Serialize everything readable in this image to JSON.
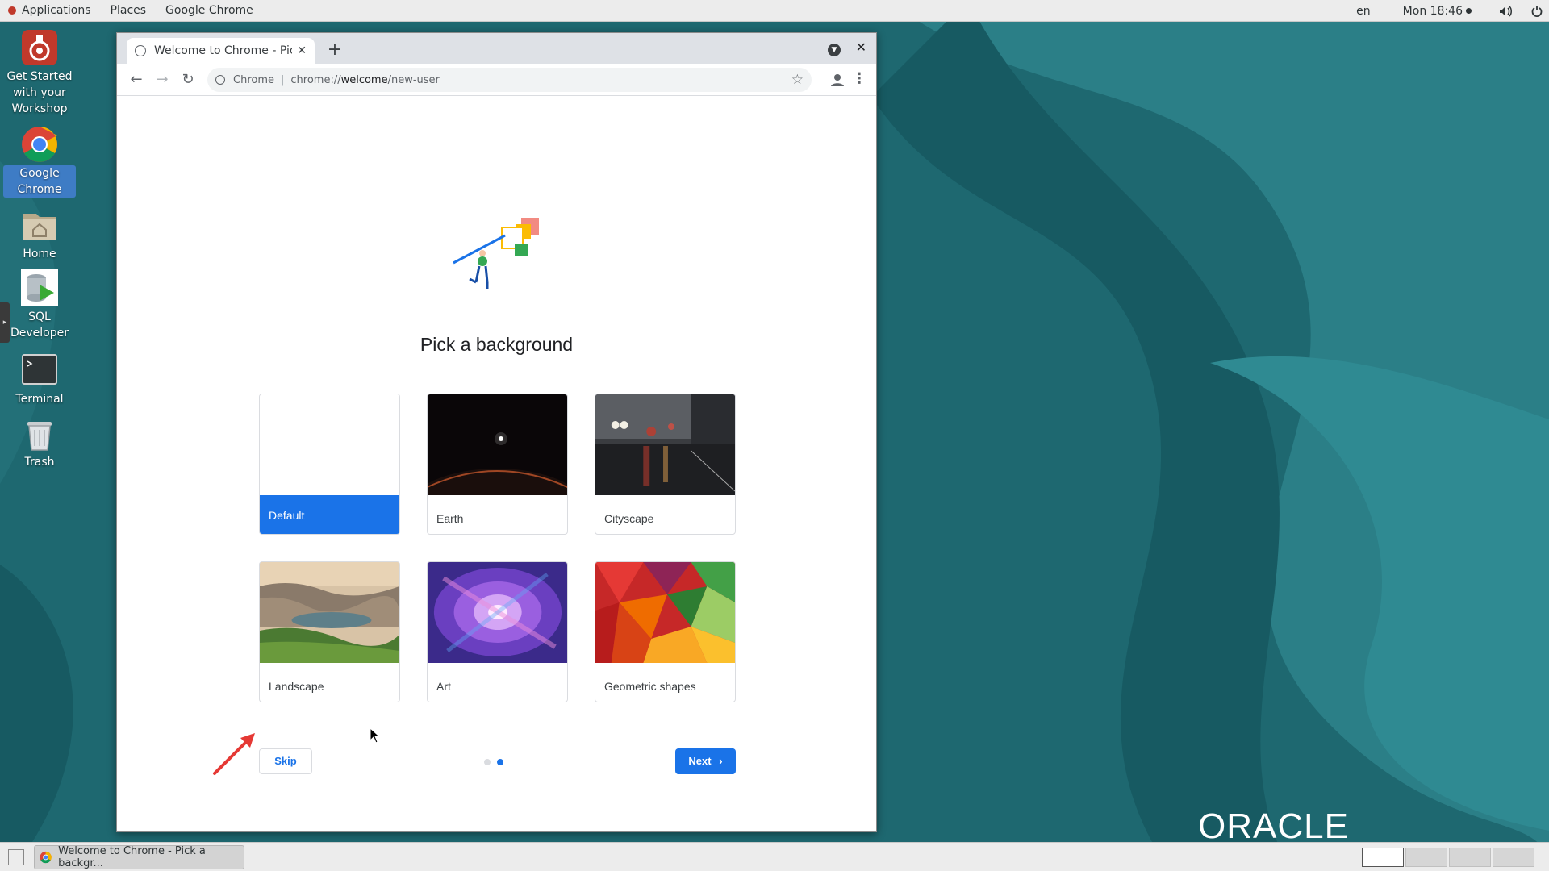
{
  "topbar": {
    "applications": "Applications",
    "places": "Places",
    "app_menu": "Google Chrome",
    "lang": "en",
    "clock": "Mon 18:46"
  },
  "desktop_icons": [
    {
      "label": "Get Started with your Workshop",
      "icon": "workshop-icon"
    },
    {
      "label": "Google Chrome",
      "icon": "chrome-icon"
    },
    {
      "label": "Home",
      "icon": "home-folder-icon"
    },
    {
      "label": "SQL Developer",
      "icon": "sql-developer-icon"
    },
    {
      "label": "Terminal",
      "icon": "terminal-icon"
    },
    {
      "label": "Trash",
      "icon": "trash-icon"
    }
  ],
  "browser": {
    "tab_title": "Welcome to Chrome - Pick",
    "omnibox_origin": "Chrome",
    "url_prefix": "chrome://",
    "url_host": "welcome",
    "url_path": "/new-user"
  },
  "welcome": {
    "heading": "Pick a background",
    "backgrounds": [
      {
        "label": "Default",
        "selected": true
      },
      {
        "label": "Earth",
        "selected": false
      },
      {
        "label": "Cityscape",
        "selected": false
      },
      {
        "label": "Landscape",
        "selected": false
      },
      {
        "label": "Art",
        "selected": false
      },
      {
        "label": "Geometric shapes",
        "selected": false
      }
    ],
    "skip_label": "Skip",
    "next_label": "Next",
    "step_current": 2,
    "step_total": 2
  },
  "branding": {
    "logo_text": "ORACLE"
  },
  "taskbar": {
    "window_title": "Welcome to Chrome - Pick a backgr..."
  },
  "colors": {
    "accent": "#1a73e8",
    "desktop_teal": "#1f6a73"
  }
}
